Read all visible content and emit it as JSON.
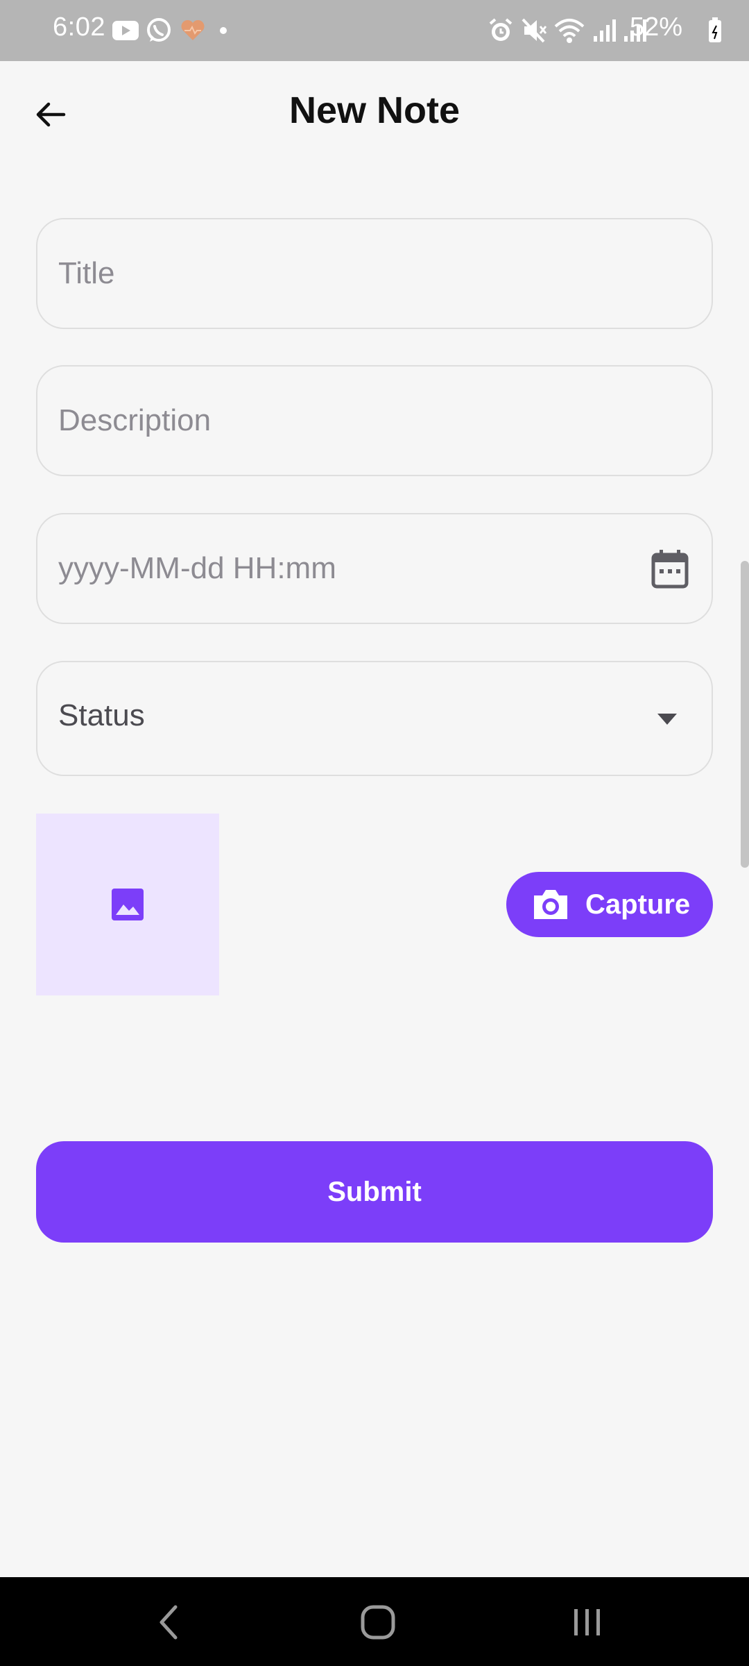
{
  "status_bar": {
    "time": "6:02",
    "battery_percent": "52%",
    "left_icons": [
      "youtube-icon",
      "whatsapp-icon",
      "health-icon",
      "dot-icon"
    ],
    "right_icons": [
      "alarm-icon",
      "mute-icon",
      "wifi-icon",
      "signal-icon",
      "signal-icon",
      "battery-icon"
    ]
  },
  "app_bar": {
    "title": "New Note",
    "back_icon": "arrow-left-icon"
  },
  "form": {
    "title_placeholder": "Title",
    "title_value": "",
    "description_placeholder": "Description",
    "description_value": "",
    "datetime_placeholder": "yyyy-MM-dd HH:mm",
    "datetime_value": "",
    "status_label": "Status",
    "status_icon": "dropdown-arrow-icon"
  },
  "image": {
    "placeholder_icon": "image-icon",
    "capture_label": "Capture",
    "capture_icon": "camera-icon"
  },
  "submit_label": "Submit",
  "colors": {
    "primary": "#7c3ef9",
    "preview_bg": "#ede4ff",
    "page_bg": "#f6f6f6",
    "status_bar_bg": "#b5b5b5",
    "nav_bar_bg": "#000000"
  },
  "nav_bar": {
    "icons": [
      "back-nav-icon",
      "home-nav-icon",
      "recents-nav-icon"
    ]
  }
}
